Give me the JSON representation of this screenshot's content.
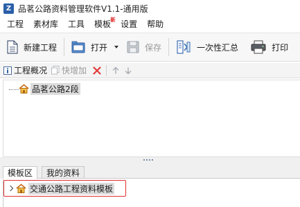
{
  "window": {
    "app_icon_letter": "Z",
    "title": "品茗公路资料管理软件V1.1-通用版"
  },
  "menubar": {
    "items": [
      {
        "label": "工程",
        "badge": ""
      },
      {
        "label": "素材库",
        "badge": ""
      },
      {
        "label": "工具",
        "badge": ""
      },
      {
        "label": "模板",
        "badge": "新"
      },
      {
        "label": "设置",
        "badge": ""
      },
      {
        "label": "帮助",
        "badge": ""
      }
    ]
  },
  "toolbar": {
    "new_project": "新建工程",
    "open": "打开",
    "save": "保存",
    "summary": "一次性汇总",
    "print": "打印"
  },
  "project_panel": {
    "overview": "工程概况",
    "quick_add": "快增加"
  },
  "project_tree": {
    "nodes": [
      {
        "label": "品茗公路2段"
      }
    ]
  },
  "bottom_tabs": {
    "tabs": [
      "模板区",
      "我的资料"
    ],
    "active_index": 0
  },
  "template_tree": {
    "nodes": [
      {
        "label": "交通公路工程资料模板"
      }
    ]
  },
  "colors": {
    "highlight_border": "#e03030",
    "selection_bg": "#dcdcdc",
    "toolbar_bg": "#f7f7f7"
  }
}
